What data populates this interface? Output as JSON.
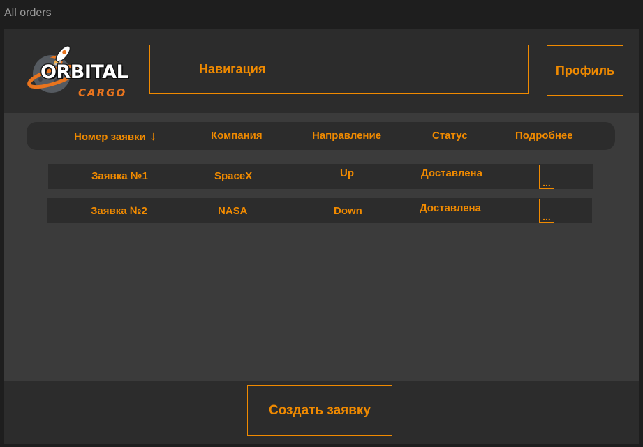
{
  "window_title": "All orders",
  "header": {
    "logo": {
      "main": "ORBITAL",
      "sub": "CARGO"
    },
    "nav_label": "Навигация",
    "profile_label": "Профиль"
  },
  "table": {
    "columns": [
      {
        "label": "Номер заявки",
        "sort_icon": "arrow-down-icon"
      },
      {
        "label": "Компания"
      },
      {
        "label": "Направление"
      },
      {
        "label": "Статус"
      },
      {
        "label": "Подробнее"
      }
    ],
    "sort_glyph": "↓",
    "rows": [
      {
        "number": "Заявка №1",
        "company": "SpaceX",
        "direction": "Up",
        "status": "Доставлена",
        "more": "..."
      },
      {
        "number": "Заявка №2",
        "company": "NASA",
        "direction": "Down",
        "status": "Доставлена",
        "more": "..."
      }
    ]
  },
  "footer": {
    "create_label": "Создать заявку"
  },
  "colors": {
    "accent": "#f08a00",
    "bg_dark": "#2c2c2c",
    "bg_content": "#3b3b3b",
    "logo_orange": "#e8741e"
  }
}
